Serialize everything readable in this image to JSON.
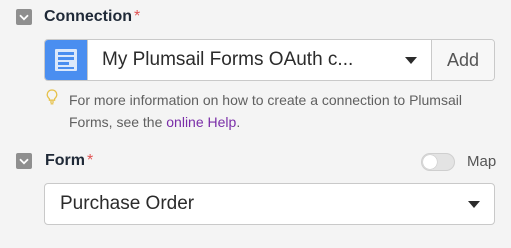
{
  "connection": {
    "label": "Connection",
    "required_mark": "*",
    "selected": "My Plumsail Forms OAuth c...",
    "add_button": "Add",
    "icon": "plumsail-forms-app-icon",
    "hint": {
      "text_before": "For more information on how to create a connection to Plumsail Forms, see the ",
      "link_text": "online Help",
      "text_after": "."
    }
  },
  "form": {
    "label": "Form",
    "required_mark": "*",
    "map_toggle_label": "Map",
    "map_toggle_on": false,
    "selected": "Purchase Order"
  },
  "colors": {
    "app_icon_bg": "#4a8ef0",
    "link": "#7a2ea8",
    "required": "#e05252"
  }
}
